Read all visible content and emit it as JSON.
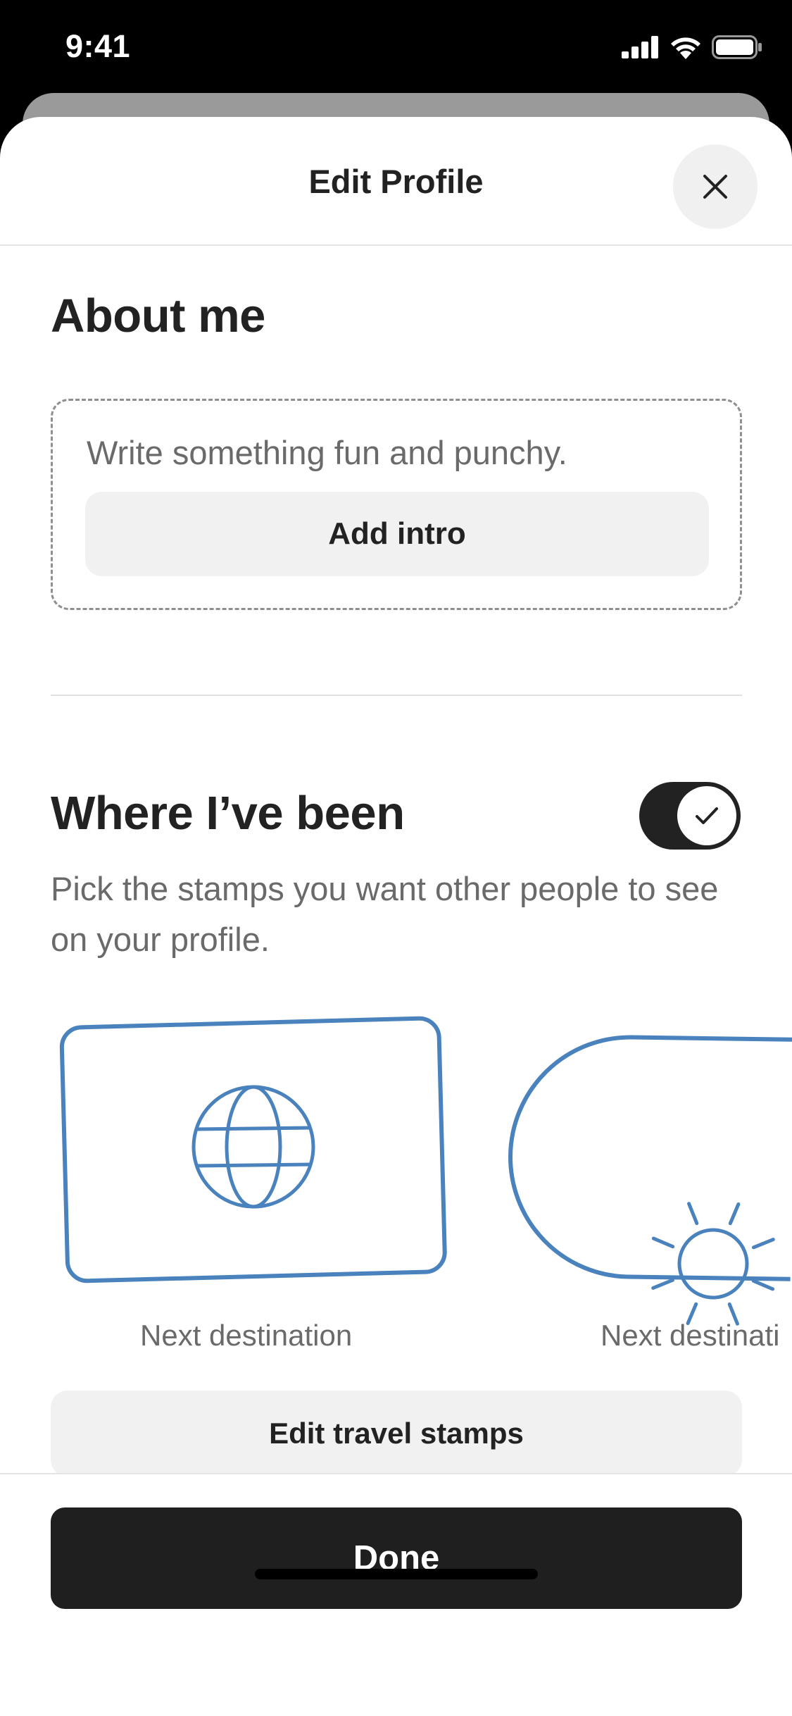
{
  "status_bar": {
    "time": "9:41"
  },
  "header": {
    "title": "Edit Profile",
    "close_icon": "close-icon"
  },
  "about": {
    "title": "About me",
    "placeholder": "Write something fun and punchy.",
    "add_intro_label": "Add intro"
  },
  "where": {
    "title": "Where I’ve been",
    "toggle_on": true,
    "description": "Pick the stamps you want other people to see on your profile.",
    "stamps": [
      {
        "label": "Next destination",
        "icon": "globe-icon"
      },
      {
        "label": "Next destinati",
        "icon": "sun-icon"
      }
    ],
    "edit_stamps_label": "Edit travel stamps"
  },
  "footer": {
    "done_label": "Done"
  },
  "colors": {
    "stamp_blue": "#4a82bd",
    "primary_dark": "#222222",
    "muted_text": "#6a6a6a"
  }
}
